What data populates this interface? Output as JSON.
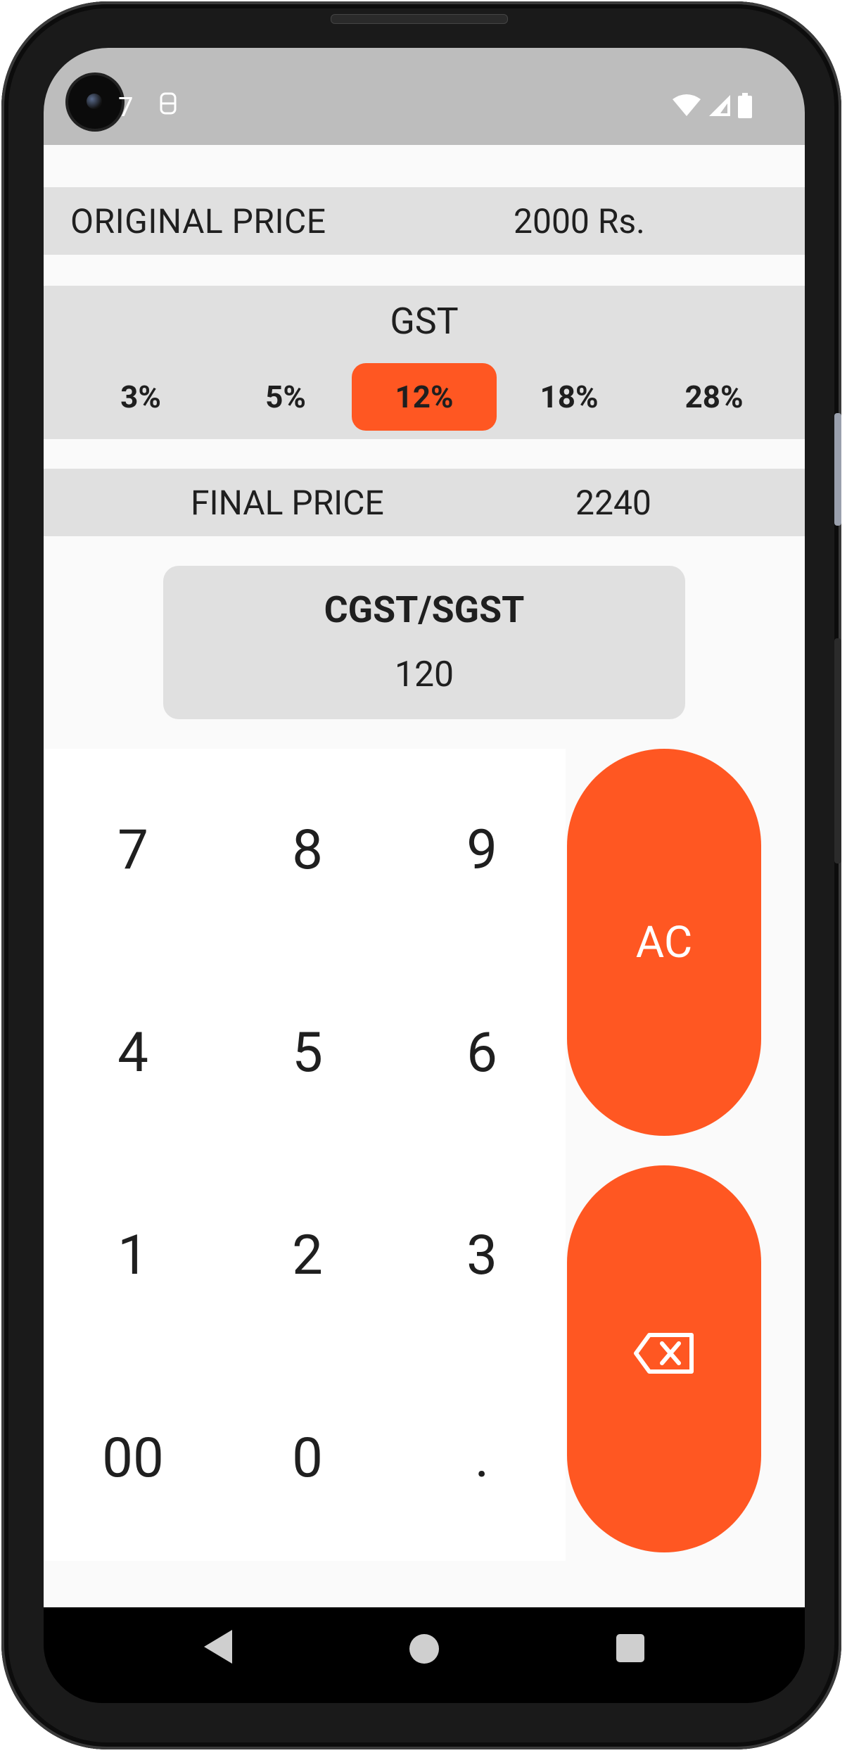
{
  "status_bar": {
    "time": "7",
    "app_icon": "notification-icon",
    "wifi_icon": "wifi-icon",
    "signal_icon": "signal-icon",
    "battery_icon": "battery-icon"
  },
  "original_price": {
    "label": "ORIGINAL PRICE",
    "value": "2000 Rs."
  },
  "gst": {
    "title": "GST",
    "options": [
      "3%",
      "5%",
      "12%",
      "18%",
      "28%"
    ],
    "selected": "12%"
  },
  "final_price": {
    "label": "FINAL PRICE",
    "value": "2240"
  },
  "tax_split": {
    "title": "CGST/SGST",
    "value": "120"
  },
  "keypad": {
    "keys": [
      "7",
      "8",
      "9",
      "4",
      "5",
      "6",
      "1",
      "2",
      "3",
      "00",
      "0",
      "."
    ],
    "clear_label": "AC",
    "backspace_icon": "backspace-icon"
  },
  "colors": {
    "accent": "#ff5722",
    "panel": "#e0e0e0",
    "background": "#fafafa",
    "status_bar": "#bdbdbd"
  },
  "nav_bar": {
    "back_icon": "back-triangle-icon",
    "home_icon": "home-circle-icon",
    "recents_icon": "recents-square-icon"
  }
}
